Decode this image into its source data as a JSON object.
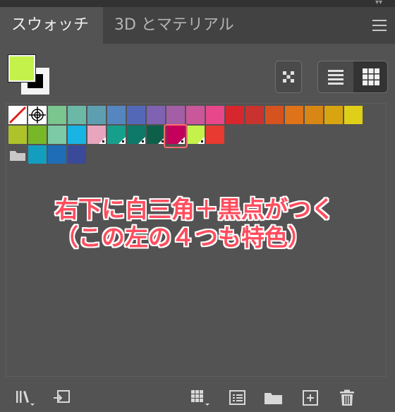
{
  "tabs": [
    {
      "label": "スウォッチ",
      "active": true
    },
    {
      "label": "3D とマテリアル",
      "active": false
    }
  ],
  "colors": {
    "fill": "#c4f24a",
    "annotation": "#ff4d5e",
    "selection_ring": "#ff6c6c"
  },
  "swatch_rows": [
    [
      "none",
      "registration",
      "#7bc58f",
      "#6cb8a6",
      "#5d9fb0",
      "#5686bf",
      "#5468b8",
      "#7f62b2",
      "#a45ea5",
      "#c9579a",
      "#e8478c",
      "#d8262f",
      "#c9332f",
      "#d6521e",
      "#de7319",
      "#d88715",
      "#d8a510",
      "#e0cf18"
    ],
    [
      "#aec32a",
      "#78b828",
      "#7ccaa6",
      "#18b4e4",
      "#e7a5be",
      "#16a08c",
      "#0e7968",
      "#0d5f4a",
      "#c4005c",
      "#c4f24a",
      "#e83a30"
    ],
    [
      "folder",
      "#139ec0",
      "#1e6db6",
      "#3b4a98"
    ]
  ],
  "spot_swatches": [
    "row1-4",
    "row1-5",
    "row1-6",
    "row1-7",
    "row1-8",
    "row1-9"
  ],
  "selected_swatch": "row1-9",
  "annotation": {
    "line1": "右下に白三角＋黒点がつく",
    "line2": "（この左の４つも特色）"
  },
  "icons": {
    "view_toggle": "kind-icon",
    "list_view": "list-view-icon",
    "grid_view": "grid-view-icon",
    "bottom": [
      "library-icon",
      "place-swatch-icon",
      "swatch-kind-icon",
      "swatch-options-icon",
      "new-group-icon",
      "new-swatch-icon",
      "delete-icon"
    ]
  }
}
